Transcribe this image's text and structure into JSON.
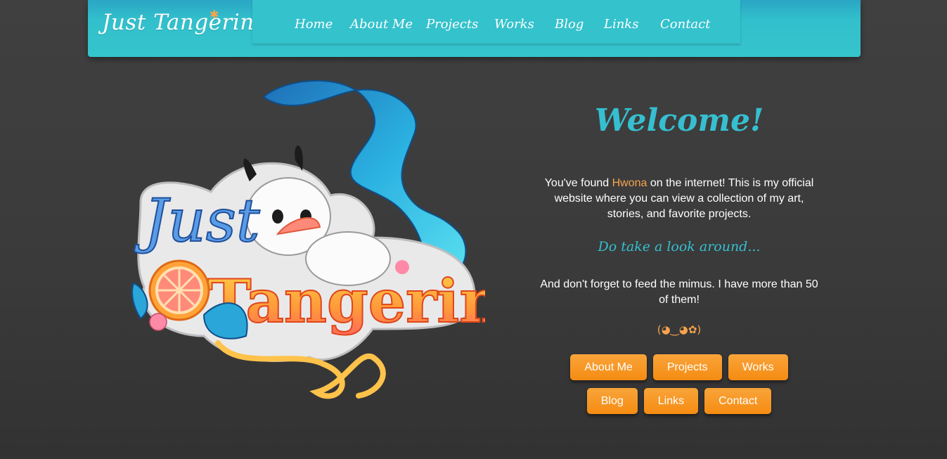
{
  "header": {
    "brand": "Just Tangerine",
    "nav": [
      "Home",
      "About Me",
      "Projects",
      "Works",
      "Blog",
      "Links",
      "Contact"
    ]
  },
  "logo": {
    "line1": "Just",
    "line2": "Tangerine"
  },
  "main": {
    "welcome": "Welcome!",
    "intro_before": "You've found ",
    "intro_name": "Hwona",
    "intro_after": " on the internet! This is my official website where you can view a collection of my art, stories, and favorite projects.",
    "subtitle": "Do take a look around...",
    "note": "And don't forget to feed the mimus. I have more than 50 of them!",
    "emote": "(◕‿◕✿)",
    "buttons_row1": [
      "About Me",
      "Projects",
      "Works"
    ],
    "buttons_row2": [
      "Blog",
      "Links",
      "Contact"
    ]
  },
  "colors": {
    "accent": "#36bfd0",
    "header_bg": "#34c2cc",
    "orange": "#f6a34c",
    "button": "#f58c12",
    "background": "#3c3c3c"
  }
}
